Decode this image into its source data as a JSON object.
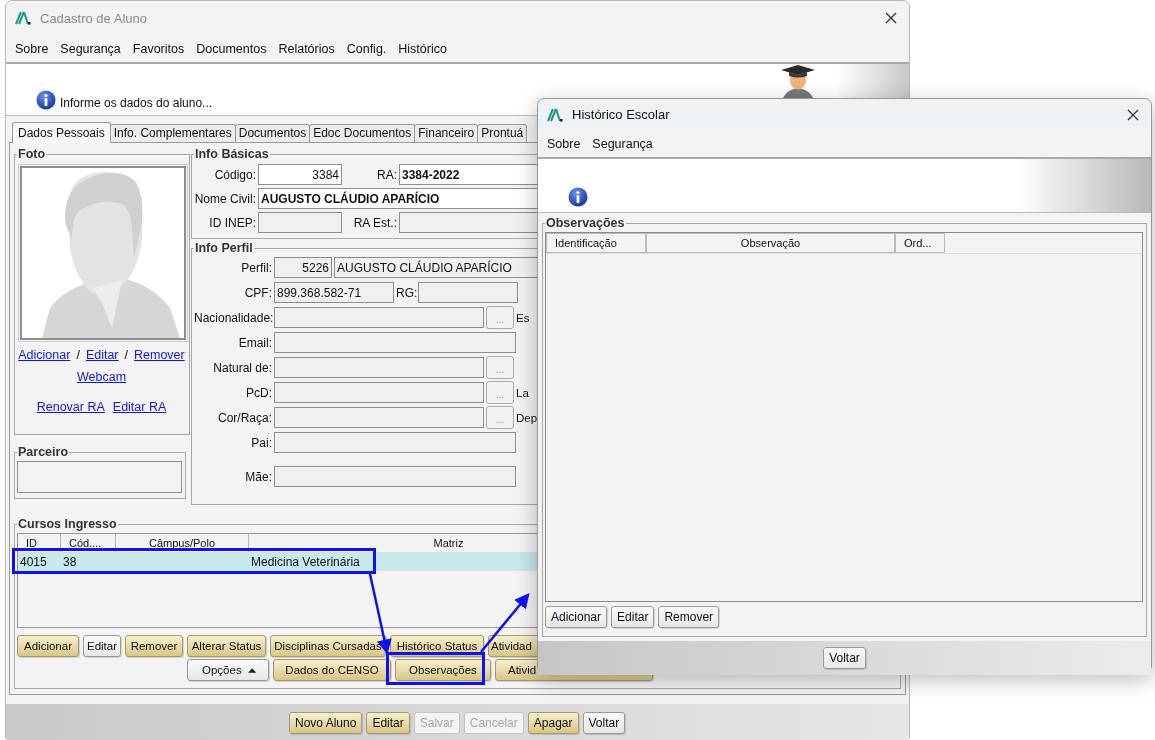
{
  "main_window": {
    "title": "Cadastro de Aluno",
    "menu": [
      "Sobre",
      "Segurança",
      "Favoritos",
      "Documentos",
      "Relatórios",
      "Config.",
      "Histórico"
    ],
    "header_message": "Informe os dados do aluno...",
    "tabs": [
      {
        "label": "Dados Pessoais",
        "selected": true
      },
      {
        "label": "Info. Complementares",
        "selected": false
      },
      {
        "label": "Documentos",
        "selected": false
      },
      {
        "label": "Edoc Documentos",
        "selected": false
      },
      {
        "label": "Financeiro",
        "selected": false
      },
      {
        "label": "Prontuá",
        "selected": false
      }
    ],
    "foto": {
      "title": "Foto",
      "link_rows": [
        [
          {
            "kind": "link",
            "text": "Adicionar"
          },
          {
            "kind": "separator",
            "text": "/"
          },
          {
            "kind": "link",
            "text": "Editar"
          },
          {
            "kind": "separator",
            "text": "/"
          },
          {
            "kind": "link",
            "text": "Remover"
          }
        ],
        [
          {
            "kind": "link",
            "text": "Webcam"
          }
        ],
        [
          {
            "kind": "link",
            "text": "Renovar RA"
          },
          {
            "kind": "link",
            "text": "Editar RA"
          }
        ]
      ]
    },
    "parceiro": {
      "title": "Parceiro"
    },
    "info_basicas": {
      "title": "Info Básicas",
      "codigo": {
        "label": "Código:",
        "value": "3384"
      },
      "ra": {
        "label": "RA:",
        "value": "3384-2022"
      },
      "nome_civil": {
        "label": "Nome Civil:",
        "value": "AUGUSTO CLÁUDIO APARÍCIO"
      },
      "id_inep": {
        "label": "ID INEP:"
      },
      "ra_est": {
        "label": "RA Est.:"
      }
    },
    "info_perfil": {
      "title": "Info Perfil",
      "rows": [
        {
          "kind": "perfil",
          "label": "Perfil:",
          "code": "5226",
          "value": "AUGUSTO CLÁUDIO APARÍCIO"
        },
        {
          "kind": "pair",
          "label": "CPF:",
          "value": "899.368.582-71",
          "label2": "RG:"
        },
        {
          "kind": "lookup",
          "label": "Nacionalidade:",
          "button": "...",
          "side_label": "Es"
        },
        {
          "kind": "text",
          "label": "Email:"
        },
        {
          "kind": "lookup",
          "label": "Natural de:",
          "button": "..."
        },
        {
          "kind": "lookup",
          "label": "PcD:",
          "button": "...",
          "side_label": "La"
        },
        {
          "kind": "lookup",
          "label": "Cor/Raça:",
          "button": "...",
          "side_label": "Dep"
        },
        {
          "kind": "text",
          "label": "Pai:"
        },
        {
          "kind": "spaced",
          "label": "Mãe:"
        }
      ]
    },
    "cursos_ingresso": {
      "title": "Cursos Ingresso",
      "columns": [
        "ID",
        "Cód....",
        "Câmpus/Polo",
        "Matriz"
      ],
      "rows": [
        {
          "id": "4015",
          "cod": "38",
          "matriz": "Medicina Veterinária",
          "selected": true
        }
      ],
      "buttons": [
        [
          {
            "label": "Adicionar",
            "kind": "gold"
          },
          {
            "label": "Editar",
            "kind": "plain"
          },
          {
            "label": "Remover",
            "kind": "gold"
          },
          {
            "label": "Alterar Status",
            "kind": "gold"
          },
          {
            "label": "Disciplinas Cursadas",
            "kind": "gold"
          },
          {
            "label": "Histórico Status",
            "kind": "gold"
          },
          {
            "label": "Atividad",
            "kind": "gold"
          }
        ],
        [
          {
            "label": "Opções",
            "kind": "menu"
          },
          {
            "label": "Dados do CENSO",
            "kind": "gold"
          },
          {
            "label": "Observações",
            "kind": "gold"
          },
          {
            "label": "Ativid",
            "kind": "gold"
          }
        ]
      ]
    },
    "footer_buttons": [
      {
        "label": "Novo Aluno",
        "kind": "gold",
        "disabled": false
      },
      {
        "label": "Editar",
        "kind": "gold",
        "disabled": false
      },
      {
        "label": "Salvar",
        "kind": "plain",
        "disabled": true
      },
      {
        "label": "Cancelar",
        "kind": "plain",
        "disabled": true
      },
      {
        "label": "Apagar",
        "kind": "gold",
        "disabled": false
      },
      {
        "label": "Voltar",
        "kind": "plain",
        "disabled": false
      }
    ]
  },
  "dialog": {
    "title": "Histórico Escolar",
    "menu": [
      "Sobre",
      "Segurança"
    ],
    "group_title": "Observações",
    "columns": [
      "Identificação",
      "Observação",
      "Ord..."
    ],
    "buttons": [
      {
        "label": "Adicionar",
        "kind": "plain"
      },
      {
        "label": "Editar",
        "kind": "plain"
      },
      {
        "label": "Remover",
        "kind": "plain"
      }
    ],
    "footer_buttons": [
      {
        "label": "Voltar",
        "kind": "plain"
      }
    ]
  }
}
